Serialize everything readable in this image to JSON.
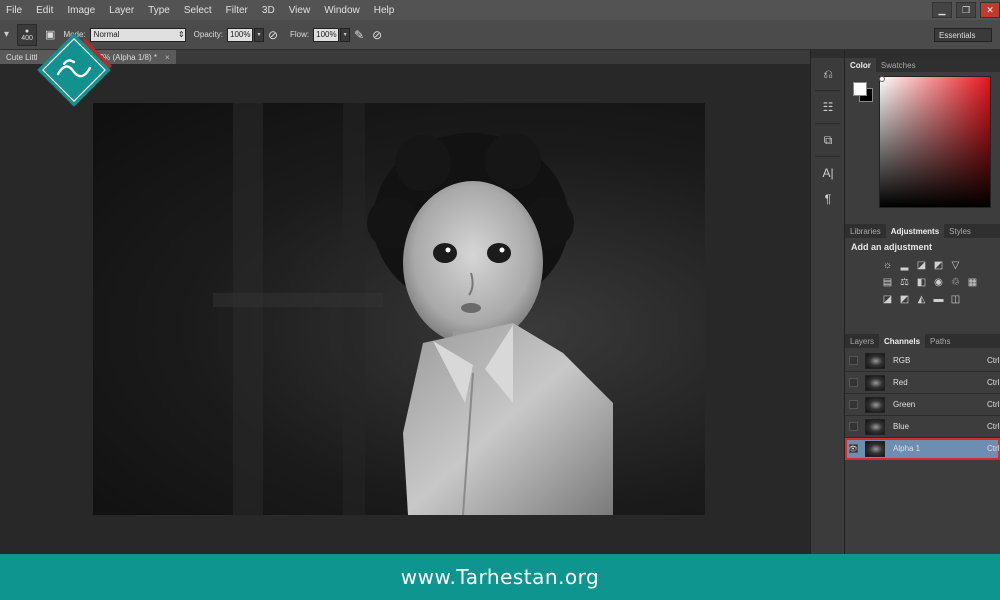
{
  "menu": {
    "items": [
      "File",
      "Edit",
      "Image",
      "Layer",
      "Type",
      "Select",
      "Filter",
      "3D",
      "View",
      "Window",
      "Help"
    ]
  },
  "window_controls": {
    "minimize": "▁",
    "restore": "❐",
    "close": "✕"
  },
  "options_bar": {
    "brush_size": "400",
    "mode_label": "Mode:",
    "mode_value": "Normal",
    "opacity_label": "Opacity:",
    "opacity_value": "100%",
    "flow_label": "Flow:",
    "flow_value": "100%",
    "workspace": "Essentials"
  },
  "document_tab": {
    "title_prefix": "Cute Littl",
    "title_suffix": "16.7% (Alpha 1/8) *",
    "close": "×"
  },
  "color_panel": {
    "tabs": [
      "Color",
      "Swatches"
    ],
    "active_tab": "Color",
    "foreground": "#ffffff",
    "background": "#000000",
    "hue": "#e8141c"
  },
  "adjust_panel": {
    "tabs": [
      "Libraries",
      "Adjustments",
      "Styles"
    ],
    "active_tab": "Adjustments",
    "title": "Add an adjustment"
  },
  "channels_panel": {
    "tabs": [
      "Layers",
      "Channels",
      "Paths"
    ],
    "active_tab": "Channels",
    "channels": [
      {
        "name": "RGB",
        "shortcut": "Ctrl"
      },
      {
        "name": "Red",
        "shortcut": "Ctrl"
      },
      {
        "name": "Green",
        "shortcut": "Ctrl"
      },
      {
        "name": "Blue",
        "shortcut": "Ctrl"
      },
      {
        "name": "Alpha 1",
        "shortcut": "Ctrl",
        "selected": true
      }
    ]
  },
  "footer": {
    "url": "www.Tarhestan.org"
  },
  "colors": {
    "footer_bg": "#0f9590",
    "selection_outline": "#d52b30",
    "logo": "#13918f"
  }
}
